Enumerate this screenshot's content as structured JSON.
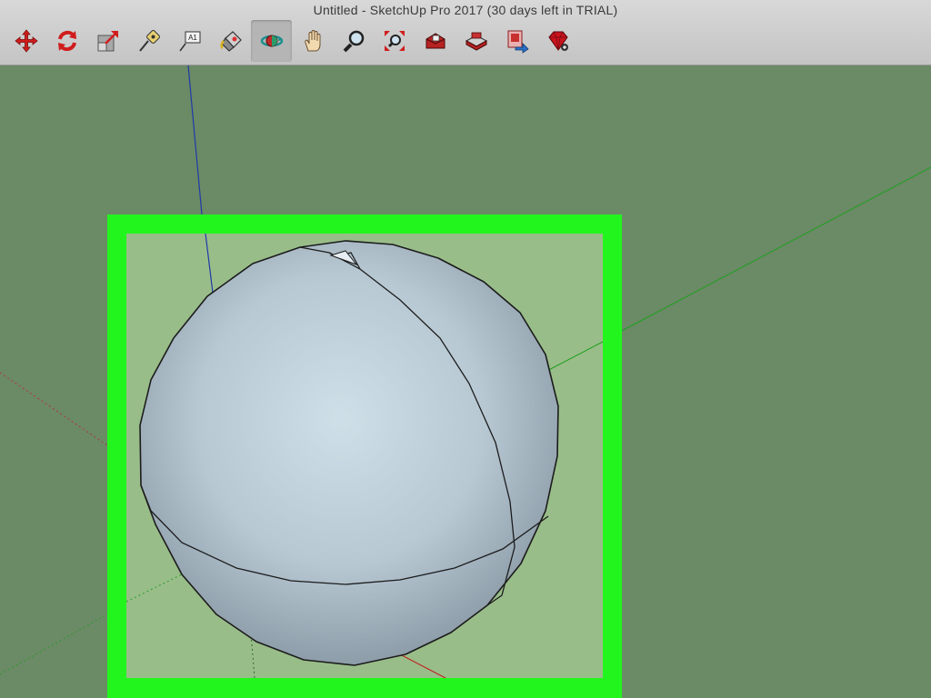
{
  "window": {
    "title": "Untitled - SketchUp Pro 2017 (30 days left in TRIAL)"
  },
  "toolbar": {
    "tools": [
      {
        "icon": "move-icon",
        "active": false
      },
      {
        "icon": "rotate-icon",
        "active": false
      },
      {
        "icon": "scale-icon",
        "active": false
      },
      {
        "icon": "tape-measure-icon",
        "active": false
      },
      {
        "icon": "text-icon",
        "active": false,
        "icon_text": "A1"
      },
      {
        "icon": "paint-bucket-icon",
        "active": false
      },
      {
        "icon": "orbit-icon",
        "active": true
      },
      {
        "icon": "pan-hand-icon",
        "active": false
      },
      {
        "icon": "zoom-icon",
        "active": false
      },
      {
        "icon": "zoom-extents-icon",
        "active": false
      },
      {
        "icon": "warehouse-icon",
        "active": false
      },
      {
        "icon": "components-icon",
        "active": false
      },
      {
        "icon": "share-model-icon",
        "active": false
      },
      {
        "icon": "ruby-extension-icon",
        "active": false
      }
    ]
  },
  "viewport": {
    "background_color": "#6b8a66",
    "model": "sphere",
    "highlight_frame_color": "#22f51e",
    "axes": {
      "blue": "#1f3aa8",
      "green": "#1ea01e",
      "red": "#c02020"
    }
  }
}
